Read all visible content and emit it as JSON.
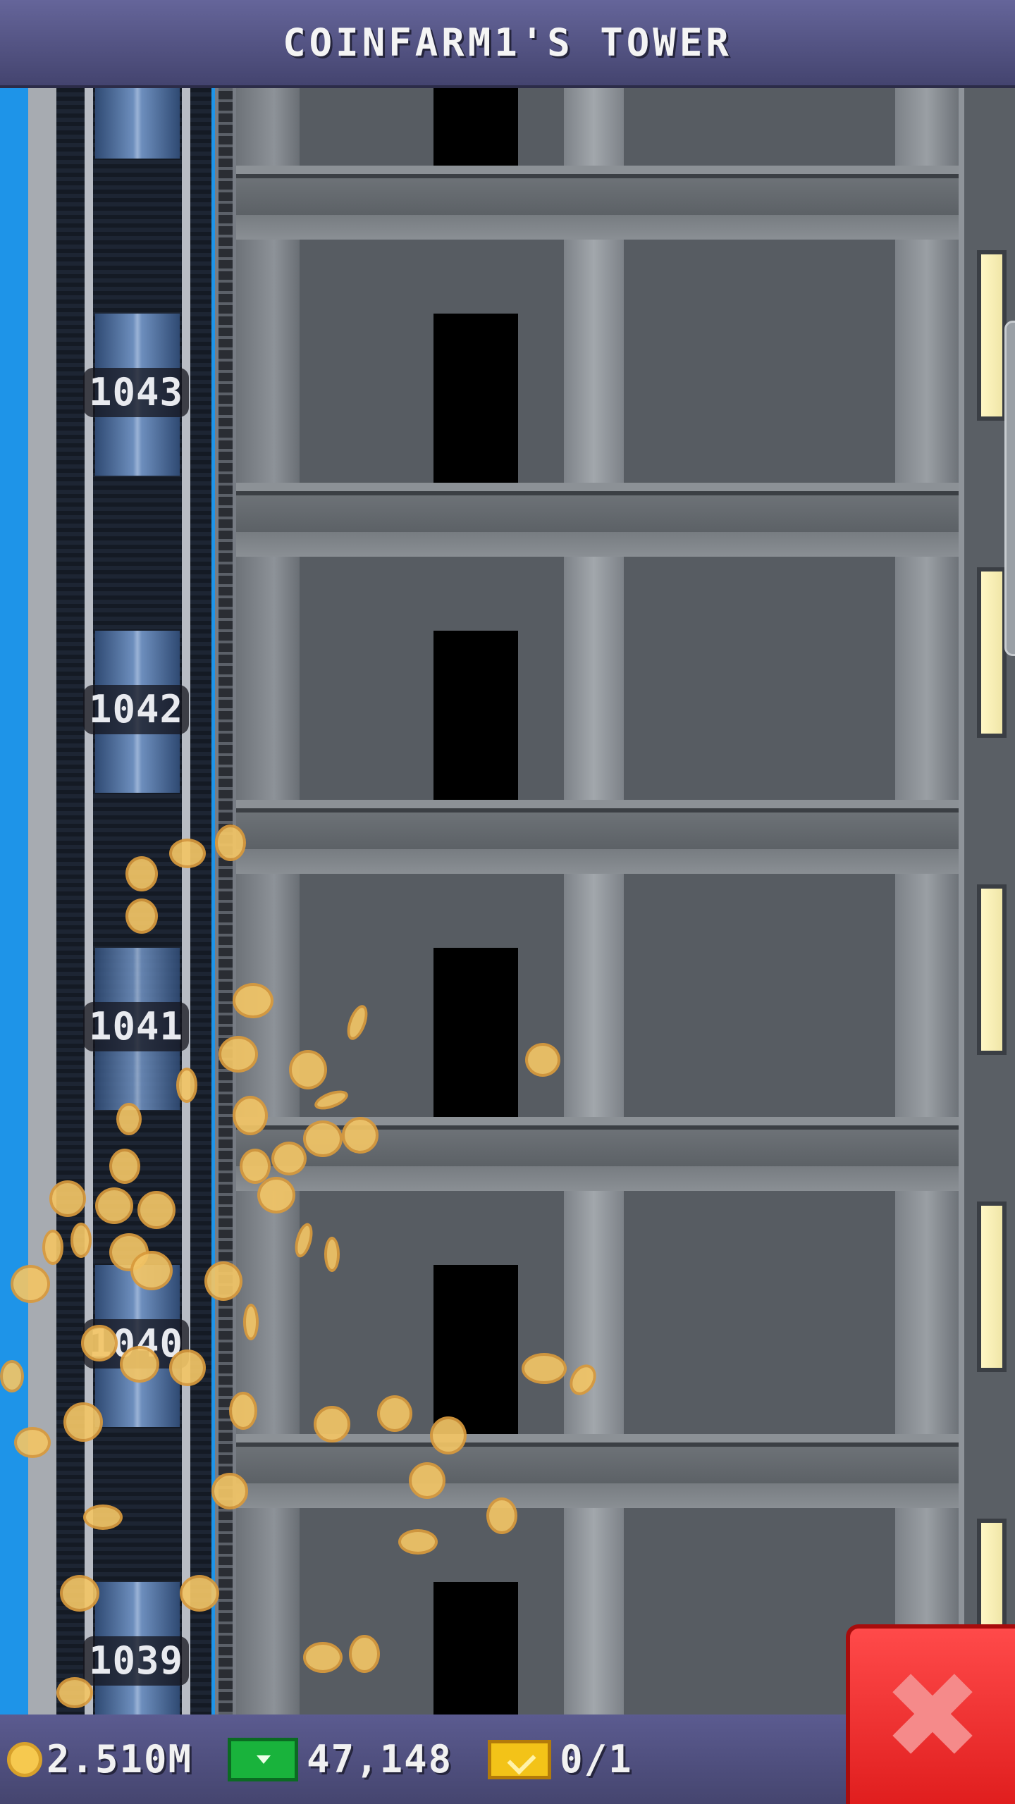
{
  "title": "COINFARM1'S TOWER",
  "floors": [
    {
      "number": "1043"
    },
    {
      "number": "1042"
    },
    {
      "number": "1041"
    },
    {
      "number": "1040"
    },
    {
      "number": "1039"
    }
  ],
  "stats": {
    "coins": "2.510M",
    "bux": "47,148",
    "tickets": "0/1"
  },
  "icons": {
    "coins": "coin-icon",
    "bux": "cash-icon",
    "tickets": "golden-ticket-icon",
    "close": "close-icon"
  },
  "close_glyph": "✖",
  "colors": {
    "sky": "#1e94e8",
    "bar": "#4f4f80",
    "close": "#e8282a"
  }
}
